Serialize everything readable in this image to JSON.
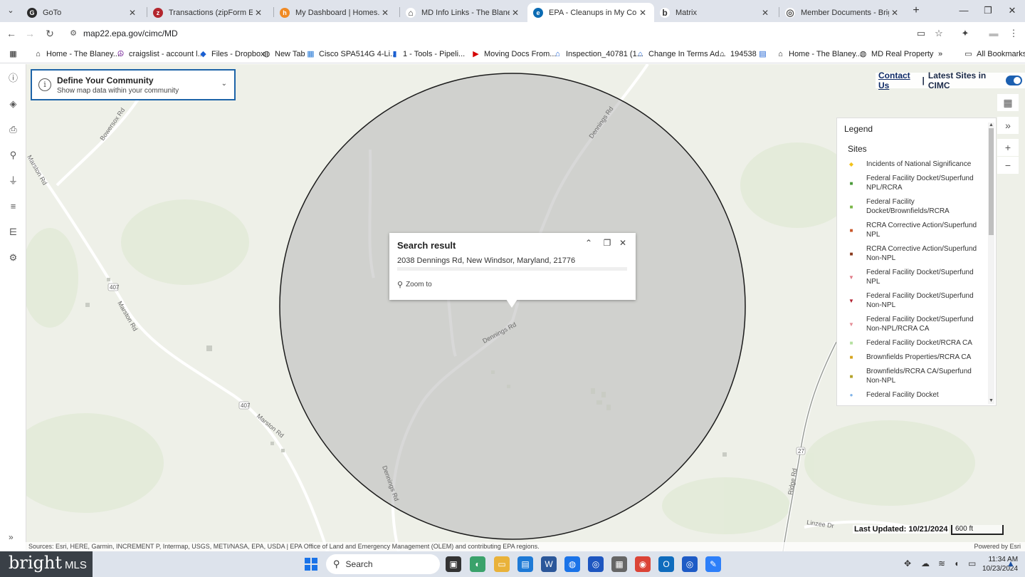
{
  "browser": {
    "tabs": [
      {
        "title": "GoTo",
        "color": "#2b2b2b",
        "glyph": "G"
      },
      {
        "title": "Transactions (zipForm Edition) |",
        "color": "#b3262e",
        "glyph": "z"
      },
      {
        "title": "My Dashboard | Homes.com",
        "color": "#f08a24",
        "glyph": "h"
      },
      {
        "title": "MD Info Links - The Blaney Gro",
        "color": "#3a3a3a",
        "glyph": "⌂"
      },
      {
        "title": "EPA - Cleanups in My Commun",
        "color": "#0b6bb3",
        "glyph": "e"
      },
      {
        "title": "Matrix",
        "color": "#555555",
        "glyph": "b"
      },
      {
        "title": "Member Documents - Bright M",
        "color": "#666666",
        "glyph": "◎"
      }
    ],
    "url": "map22.epa.gov/cimc/MD",
    "bookmarks": [
      {
        "label": "Home - The Blaney...",
        "glyph": "⌂"
      },
      {
        "label": "craigslist - account l...",
        "glyph": "☮"
      },
      {
        "label": "Files - Dropbox",
        "glyph": "◆"
      },
      {
        "label": "New Tab",
        "glyph": "◍"
      },
      {
        "label": "Cisco SPA514G 4-Li...",
        "glyph": "▦"
      },
      {
        "label": "1 - Tools - Pipeli...",
        "glyph": "▮"
      },
      {
        "label": "Moving Docs From...",
        "glyph": "▶"
      },
      {
        "label": "Inspection_40781 (1...",
        "glyph": "⌂"
      },
      {
        "label": "Change In Terms Ad...",
        "glyph": "⌂"
      },
      {
        "label": "194538",
        "glyph": "⌂"
      },
      {
        "label": "",
        "glyph": "▤"
      },
      {
        "label": "Home - The Blaney...",
        "glyph": "⌂"
      },
      {
        "label": "MD Real Property",
        "glyph": "◍"
      }
    ],
    "all_bookmarks": "All Bookmarks"
  },
  "app": {
    "define": {
      "title": "Define Your Community",
      "subtitle": "Show map data within your community"
    },
    "contact": "Contact Us",
    "separator": "|",
    "latest": "Latest Sites in CIMC",
    "legend": {
      "title": "Legend",
      "section": "Sites",
      "items": [
        {
          "label": "Incidents of National Significance",
          "sym": "◆",
          "color": "#f2c21b"
        },
        {
          "label": "Federal Facility Docket/Superfund NPL/RCRA",
          "sym": "■",
          "color": "#4a9a3a"
        },
        {
          "label": "Federal Facility Docket/Brownfields/RCRA",
          "sym": "■",
          "color": "#7ab648"
        },
        {
          "label": "RCRA Corrective Action/Superfund NPL",
          "sym": "■",
          "color": "#c9572a"
        },
        {
          "label": "RCRA Corrective Action/Superfund Non-NPL",
          "sym": "■",
          "color": "#8a3a1d"
        },
        {
          "label": "Federal Facility Docket/Superfund NPL",
          "sym": "▼",
          "color": "#e07a87"
        },
        {
          "label": "Federal Facility Docket/Superfund Non-NPL",
          "sym": "▼",
          "color": "#b22232"
        },
        {
          "label": "Federal Facility Docket/Superfund Non-NPL/RCRA CA",
          "sym": "▼",
          "color": "#e58d96"
        },
        {
          "label": "Federal Facility Docket/RCRA CA",
          "sym": "■",
          "color": "#b5e0a0"
        },
        {
          "label": "Brownfields Properties/RCRA CA",
          "sym": "■",
          "color": "#d6a41e"
        },
        {
          "label": "Brownfields/RCRA CA/Superfund Non-NPL",
          "sym": "■",
          "color": "#b3a22a"
        },
        {
          "label": "Federal Facility Docket",
          "sym": "●",
          "color": "#7fb2e8"
        }
      ]
    },
    "popup": {
      "title": "Search result",
      "address": "2038 Dennings Rd, New Windsor, Maryland, 21776",
      "zoom": "Zoom to"
    },
    "map_labels": {
      "dennings_rd_1": "Dennings Rd",
      "dennings_rd_2": "Dennings Rd",
      "dennings_rd_3": "Dennings Rd",
      "bowers_rd": "Bowersox Rd",
      "marston_rd_1": "Marston Rd",
      "marston_rd_2": "Marston Rd",
      "marston_rd_3": "Marston Rd",
      "ridge_rd": "Ridge Rd",
      "linzee_dr": "Linzee Dr",
      "route_407a": "407",
      "route_407b": "407",
      "route_27": "27"
    },
    "last_updated": "Last Updated: 10/21/2024",
    "scale": "600 ft",
    "attribution": "Sources: Esri, HERE, Garmin, INCREMENT P, Intermap, USGS, METI/NASA, EPA, USDA | EPA Office of Land and Emergency Management (OLEM) and contributing EPA regions.",
    "powered": "Powered by Esri"
  },
  "taskbar": {
    "brand": "bright",
    "brand_suffix": "MLS",
    "search": "Search",
    "time": "11:34 AM",
    "date": "10/23/2024"
  }
}
